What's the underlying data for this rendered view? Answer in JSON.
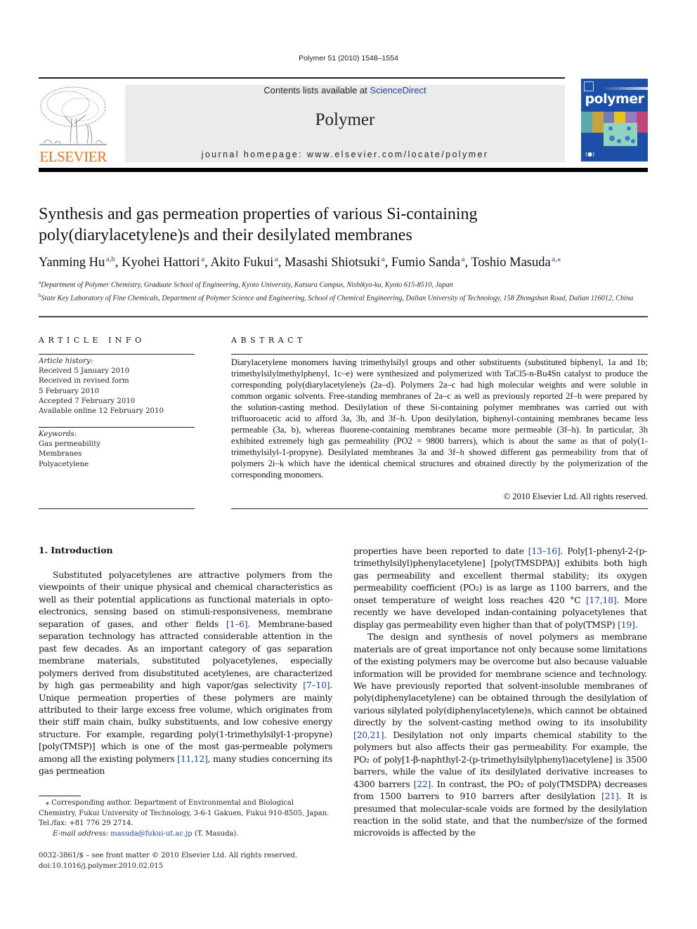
{
  "header": {
    "citation": "Polymer 51 (2010) 1548–1554",
    "contents_prefix": "Contents lists available at ",
    "contents_link": "ScienceDirect",
    "journal_name": "Polymer",
    "homepage": "journal homepage: www.elsevier.com/locate/polymer",
    "publisher_logo_text": "ELSEVIER",
    "cover_title": "polymer",
    "colors": {
      "link": "#1c3fa0",
      "elsevier_orange": "#e8731f",
      "cover_blue": "#1d4fa8",
      "band_gray": "#ebebeb"
    }
  },
  "article": {
    "title_line1": "Synthesis and gas permeation properties of various Si-containing",
    "title_line2": "poly(diarylacetylene)s and their desilylated membranes",
    "authors": [
      {
        "name": "Yanming Hu",
        "sup": "a,b"
      },
      {
        "name": "Kyohei Hattori",
        "sup": "a"
      },
      {
        "name": "Akito Fukui",
        "sup": "a"
      },
      {
        "name": "Masashi Shiotsuki",
        "sup": "a"
      },
      {
        "name": "Fumio Sanda",
        "sup": "a"
      },
      {
        "name": "Toshio Masuda",
        "sup": "a,⁎"
      }
    ],
    "affiliations": [
      {
        "mark": "a",
        "text": "Department of Polymer Chemistry, Graduate School of Engineering, Kyoto University, Katsura Campus, Nishikyo-ku, Kyoto 615-8510, Japan"
      },
      {
        "mark": "b",
        "text": "State Key Laboratory of Fine Chemicals, Department of Polymer Science and Engineering, School of Chemical Engineering, Dalian University of Technology, 158 Zhongshan Road, Dalian 116012, China"
      }
    ]
  },
  "article_info": {
    "heading": "ARTICLE INFO",
    "history_label": "Article history:",
    "history": [
      "Received 5 January 2010",
      "Received in revised form",
      "5 February 2010",
      "Accepted 7 February 2010",
      "Available online 12 February 2010"
    ],
    "keywords_label": "Keywords:",
    "keywords": [
      "Gas permeability",
      "Membranes",
      "Polyacetylene"
    ]
  },
  "abstract": {
    "heading": "ABSTRACT",
    "text": "Diarylacetylene monomers having trimethylsilyl groups and other substituents (substituted biphenyl, 1a and 1b; trimethylsilylmethylphenyl, 1c–e) were synthesized and polymerized with TaCl5-n-Bu4Sn catalyst to produce the corresponding poly(diarylacetylene)s (2a–d). Polymers 2a–c had high molecular weights and were soluble in common organic solvents. Free-standing membranes of 2a–c as well as previously reported 2f–h were prepared by the solution-casting method. Desilylation of these Si-containing polymer membranes was carried out with trifluoroacetic acid to afford 3a, 3b, and 3f–h. Upon desilylation, biphenyl-containing membranes became less permeable (3a, b), whereas fluorene-containing membranes became more permeable (3f–h). In particular, 3h exhibited extremely high gas permeability (PO2 = 9800 barrers), which is about the same as that of poly(1-trimethylsilyl-1-propyne). Desilylated membranes 3a and 3f–h showed different gas permeability from that of polymers 2i–k which have the identical chemical structures and obtained directly by the polymerization of the corresponding monomers.",
    "copyright": "© 2010 Elsevier Ltd. All rights reserved."
  },
  "introduction": {
    "heading": "1.  Introduction",
    "left_para": [
      {
        "t": "Substituted polyacetylenes are attractive polymers from the viewpoints of their unique physical and chemical characteristics as well as their potential applications as functional materials in opto-electronics, sensing based on stimuli-responsiveness, membrane separation of gases, and other fields "
      },
      {
        "r": "[1–6]"
      },
      {
        "t": ". Membrane-based separation technology has attracted considerable attention in the past few decades. As an important category of gas separation membrane materials, substituted polyacetylenes, especially polymers derived from disubstituted acetylenes, are characterized by high gas permeability and high vapor/gas selectivity "
      },
      {
        "r": "[7–10]"
      },
      {
        "t": ". Unique permeation properties of these polymers are mainly attributed to their large excess free volume, which originates from their stiff main chain, bulky substituents, and low cohesive energy structure. For example, regarding poly(1-trimethylsilyl-1-propyne) [poly(TMSP)] which is one of the most gas-permeable polymers among all the existing polymers "
      },
      {
        "r": "[11,12]"
      },
      {
        "t": ", many studies concerning its gas permeation"
      }
    ],
    "right_para1": [
      {
        "t": "properties have been reported to date "
      },
      {
        "r": "[13–16]"
      },
      {
        "t": ". Poly[1-phenyl-2-(p-trimethylsilyl)phenylacetylene] [poly(TMSDPA)] exhibits both high gas permeability and excellent thermal stability; its oxygen permeability coefficient (PO₂) is as large as 1100 barrers, and the onset temperature of weight loss reaches 420 °C "
      },
      {
        "r": "[17,18]"
      },
      {
        "t": ". More recently we have developed indan-containing polyacetylenes that display gas permeability even higher than that of poly(TMSP) "
      },
      {
        "r": "[19]"
      },
      {
        "t": "."
      }
    ],
    "right_para2": [
      {
        "t": "The design and synthesis of novel polymers as membrane materials are of great importance not only because some limitations of the existing polymers may be overcome but also because valuable information will be provided for membrane science and technology. We have previously reported that solvent-insoluble membranes of poly(diphenylacetylene) can be obtained through the desilylation of various silylated poly(diphenylacetylene)s, which cannot be obtained directly by the solvent-casting method owing to its insolubility "
      },
      {
        "r": "[20,21]"
      },
      {
        "t": ". Desilylation not only imparts chemical stability to the polymers but also affects their gas permeability. For example, the PO₂ of poly[1-β-naphthyl-2-(p-trimethylsilylphenyl)acetylene] is 3500 barrers, while the value of its desilylated derivative increases to 4300 barrers "
      },
      {
        "r": "[22]"
      },
      {
        "t": ". In contrast, the PO₂ of poly(TMSDPA) decreases from 1500 barrers to 910 barrers after desilylation "
      },
      {
        "r": "[21]"
      },
      {
        "t": ". It is presumed that molecular-scale voids are formed by the desilylation reaction in the solid state, and that the number/size of the formed microvoids is affected by the"
      }
    ]
  },
  "footnote": {
    "star": "⁎",
    "corresponding": "Corresponding author. Department of Environmental and Biological Chemistry, Fukui University of Technology, 3-6-1 Gakuen, Fukui 910-8505, Japan. Tel./fax: +81 776 29 2714.",
    "email_label": "E-mail address:",
    "email": "masuda@fukui-ut.ac.jp",
    "email_suffix": " (T. Masuda).",
    "issn": "0032-3861/$ – see front matter © 2010 Elsevier Ltd. All rights reserved.",
    "doi": "doi:10.1016/j.polymer.2010.02.015"
  }
}
